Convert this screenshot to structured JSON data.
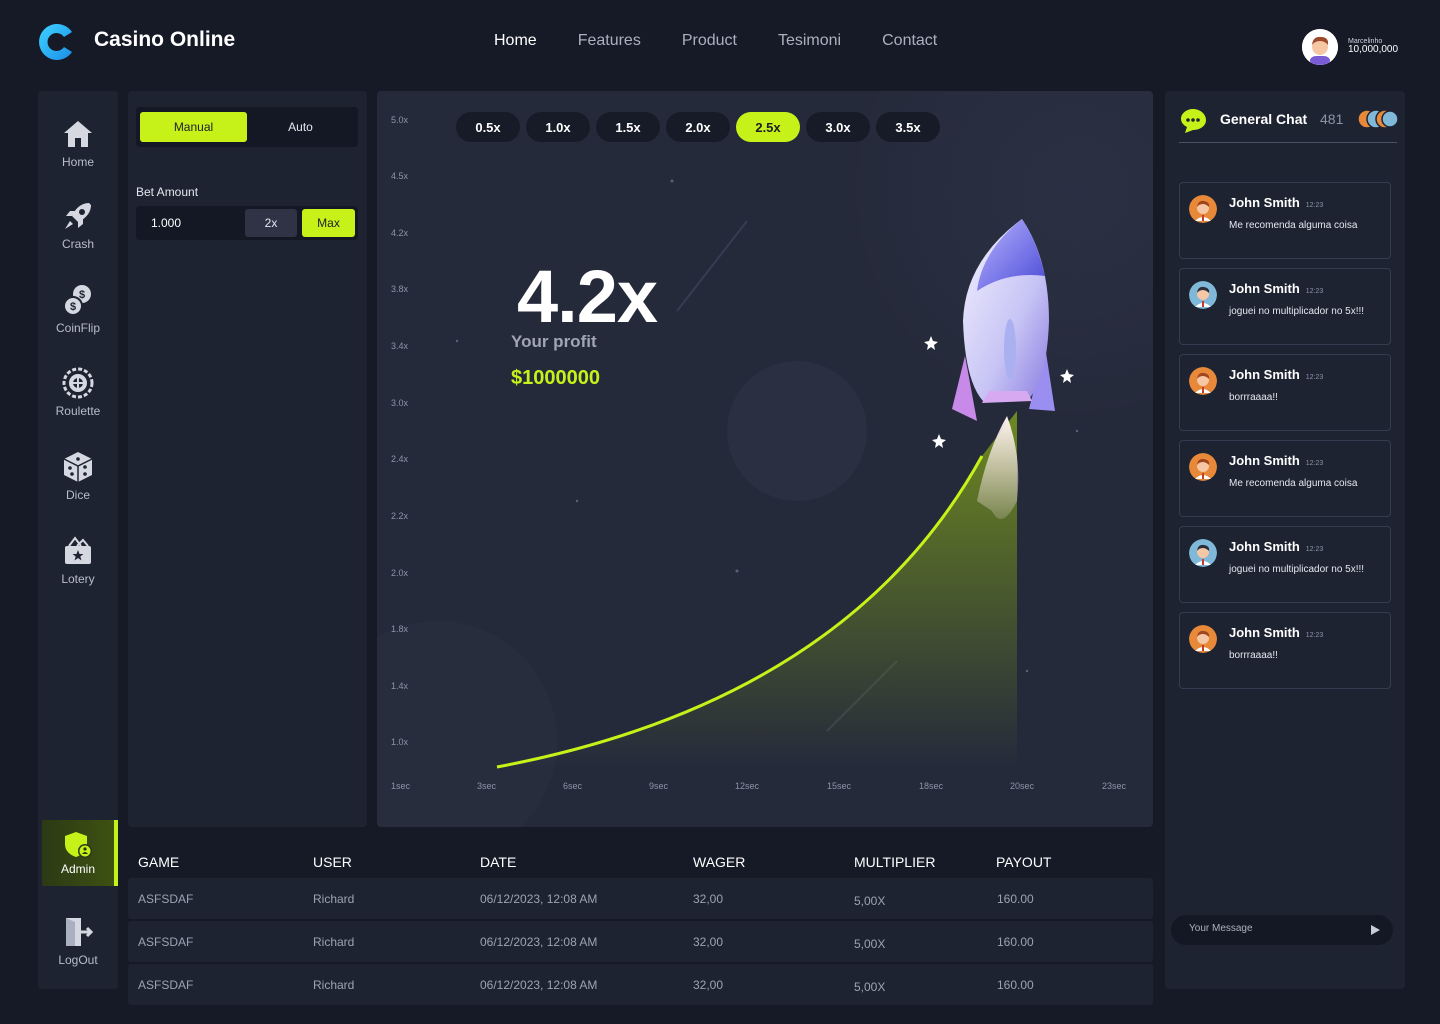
{
  "app": {
    "brand": "Casino Online"
  },
  "nav": {
    "items": [
      "Home",
      "Features",
      "Product",
      "Tesimoni",
      "Contact"
    ]
  },
  "profile": {
    "name": "Marcelinho",
    "balance": "10,000,000"
  },
  "sidebar": {
    "items": [
      "Home",
      "Crash",
      "CoinFlip",
      "Roulette",
      "Dice",
      "Lotery"
    ],
    "admin": "Admin",
    "logout": "LogOut"
  },
  "bet": {
    "mode_manual": "Manual",
    "mode_auto": "Auto",
    "label": "Bet Amount",
    "amount": "1.000",
    "double": "2x",
    "max": "Max"
  },
  "game": {
    "multipliers": [
      "0.5x",
      "1.0x",
      "1.5x",
      "2.0x",
      "2.5x",
      "3.0x",
      "3.5x"
    ],
    "selected_multiplier": "2.5x",
    "current": "4.2x",
    "profit_label": "Your profit",
    "profit_value": "$1000000",
    "y_ticks": [
      "5.0x",
      "4.5x",
      "4.2x",
      "3.8x",
      "3.4x",
      "3.0x",
      "2.4x",
      "2.2x",
      "2.0x",
      "1.8x",
      "1.4x",
      "1.0x"
    ],
    "x_ticks": [
      "1sec",
      "3sec",
      "6sec",
      "9sec",
      "12sec",
      "15sec",
      "18sec",
      "20sec",
      "23sec"
    ],
    "accent": "#c7f219"
  },
  "table": {
    "headers": [
      "GAME",
      "USER",
      "DATE",
      "WAGER",
      "MULTIPLIER",
      "PAYOUT"
    ],
    "rows": [
      [
        "ASFSDAF",
        "Richard",
        "06/12/2023, 12:08 AM",
        "32,00",
        "5,00X",
        "160.00"
      ],
      [
        "ASFSDAF",
        "Richard",
        "06/12/2023, 12:08 AM",
        "32,00",
        "5,00X",
        "160.00"
      ],
      [
        "ASFSDAF",
        "Richard",
        "06/12/2023, 12:08 AM",
        "32,00",
        "5,00X",
        "160.00"
      ]
    ]
  },
  "chat": {
    "title": "General Chat",
    "count": "481",
    "placeholder": "Your Message",
    "messages": [
      {
        "name": "John Smith",
        "time": "12:23",
        "text": "Me recomenda alguma coisa"
      },
      {
        "name": "John Smith",
        "time": "12:23",
        "text": "joguei no multiplicador no 5x!!!"
      },
      {
        "name": "John Smith",
        "time": "12:23",
        "text": "borrraaaa!!"
      },
      {
        "name": "John Smith",
        "time": "12:23",
        "text": "Me recomenda alguma coisa"
      },
      {
        "name": "John Smith",
        "time": "12:23",
        "text": "joguei no multiplicador no 5x!!!"
      },
      {
        "name": "John Smith",
        "time": "12:23",
        "text": "borrraaaa!!"
      }
    ]
  }
}
